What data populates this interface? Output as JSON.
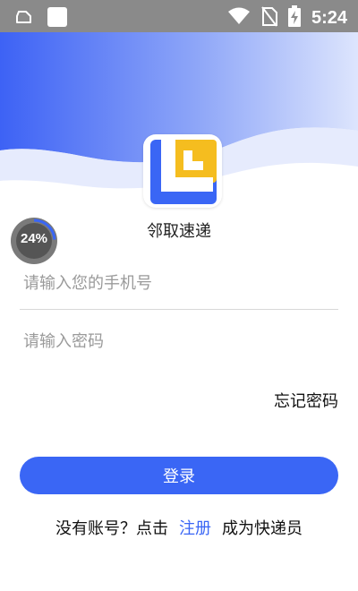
{
  "status_bar": {
    "time": "5:24",
    "icons": [
      "cloud-outline-icon",
      "app-square-icon",
      "wifi-icon",
      "no-sim-icon",
      "battery-charging-icon"
    ]
  },
  "colors": {
    "status_bar": "#8a8a8a",
    "accent": "#3a66f5",
    "logo_yellow": "#f5bd1f",
    "logo_blue": "#3a66f5"
  },
  "app": {
    "name": "邻取速递",
    "logo_icon": "app-logo-icon"
  },
  "progress": {
    "value": 0.24,
    "label": "24%"
  },
  "form": {
    "phone_placeholder": "请输入您的手机号",
    "password_placeholder": "请输入密码",
    "forgot_label": "忘记密码",
    "login_label": "登录"
  },
  "register": {
    "prefix": "没有账号？点击",
    "link": "注册",
    "suffix": "成为快递员"
  }
}
